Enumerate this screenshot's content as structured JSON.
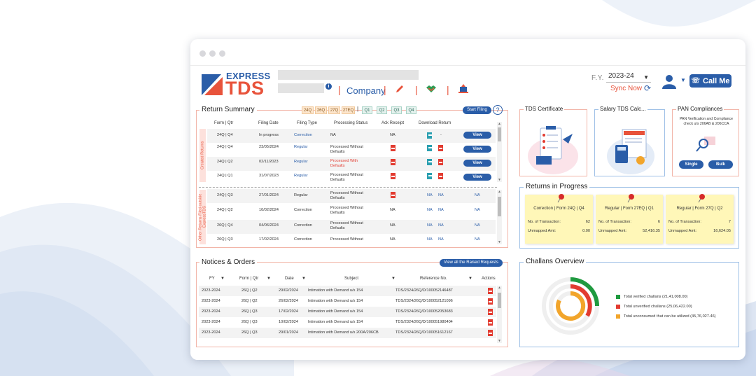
{
  "header": {
    "logo_express": "EXPRESS",
    "logo_tds": "TDS",
    "company_label": "Company",
    "fy_label": "F.Y.",
    "fy_value": "2023-24",
    "sync_now": "Sync Now",
    "call_me": "Call Me"
  },
  "return_summary": {
    "title": "Return Summary",
    "form_tags": [
      "24Q",
      "26Q",
      "27Q",
      "27EQ"
    ],
    "quarter_tags": [
      "Q1",
      "Q2",
      "Q3",
      "Q4"
    ],
    "start_filing": "Start Filing",
    "help": "?",
    "columns": [
      "Form | Qtr",
      "Filing Date",
      "Filing Type",
      "Processing Status",
      "Ack Receipt",
      "Download Return"
    ],
    "created_label": "Created Returns",
    "other_label": "Other Returns Filed outside ExpressTDS",
    "created_rows": [
      {
        "form": "24Q | Q4",
        "date": "In progress",
        "type": "Correction",
        "status": "NA",
        "ack": "NA",
        "download": "-",
        "action": "View"
      },
      {
        "form": "24Q | Q4",
        "date": "23/05/2024",
        "type": "Regular",
        "status": "Processed Without Defaults",
        "ack": "",
        "download": "",
        "action": "View"
      },
      {
        "form": "24Q | Q2",
        "date": "02/11/2023",
        "type": "Regular",
        "status": "Processed With Defaults",
        "ack": "",
        "download": "",
        "action": "View"
      },
      {
        "form": "24Q | Q1",
        "date": "31/07/2023",
        "type": "Regular",
        "status": "Processed Without Defaults",
        "ack": "",
        "download": "",
        "action": "View"
      }
    ],
    "other_rows": [
      {
        "form": "24Q | Q3",
        "date": "27/01/2024",
        "type": "Regular",
        "status": "Processed Without Defaults",
        "ack": "",
        "dl1": "NA",
        "dl2": "NA",
        "action": "NA"
      },
      {
        "form": "24Q | Q2",
        "date": "10/02/2024",
        "type": "Correction",
        "status": "Processed Without Defaults",
        "ack": "NA",
        "dl1": "NA",
        "dl2": "NA",
        "action": "NA"
      },
      {
        "form": "26Q | Q4",
        "date": "04/06/2024",
        "type": "Correction",
        "status": "Processed Without Defaults",
        "ack": "NA",
        "dl1": "NA",
        "dl2": "NA",
        "action": "NA"
      },
      {
        "form": "26Q | Q3",
        "date": "17/02/2024",
        "type": "Correction",
        "status": "Processed Without",
        "ack": "NA",
        "dl1": "NA",
        "dl2": "NA",
        "action": "NA"
      }
    ]
  },
  "notices": {
    "title": "Notices & Orders",
    "view_all": "View all the Raised Requests",
    "columns": [
      "FY",
      "Form | Qtr",
      "Date",
      "Subject",
      "Reference No.",
      "Actions"
    ],
    "rows": [
      {
        "fy": "2023-2024",
        "form": "26Q | Q2",
        "date": "29/02/2024",
        "subject": "Intimation with Demand u/s 154",
        "ref": "TDS/2324/26Q/D/100052146487"
      },
      {
        "fy": "2023-2024",
        "form": "26Q | Q2",
        "date": "26/02/2024",
        "subject": "Intimation with Demand u/s 154",
        "ref": "TDS/2324/26Q/D/100052121096"
      },
      {
        "fy": "2023-2024",
        "form": "26Q | Q3",
        "date": "17/02/2024",
        "subject": "Intimation with Demand u/s 154",
        "ref": "TDS/2324/26Q/D/100052053683"
      },
      {
        "fy": "2023-2024",
        "form": "26Q | Q3",
        "date": "10/02/2024",
        "subject": "Intimation with Demand u/s 154",
        "ref": "TDS/2324/26Q/D/100051980404"
      },
      {
        "fy": "2023-2024",
        "form": "26Q | Q3",
        "date": "29/01/2024",
        "subject": "Intimation with Demand u/s 200A/206CB",
        "ref": "TDS/2324/26Q/D/100051612167"
      }
    ]
  },
  "cards": {
    "tds_certificate": "TDS Certificate",
    "salary_calc": "Salary TDS Calc...",
    "pan_title": "PAN Compliances",
    "pan_desc": "PAN Verification and Compliance check u/s 206AB & 206CCA",
    "single": "Single",
    "bulk": "Bulk"
  },
  "returns_in_progress": {
    "title": "Returns in Progress",
    "txn_label": "No. of Transaction:",
    "amt_label": "Unmapped Amt:",
    "notes": [
      {
        "title": "Correction | Form 24Q | Q4",
        "txn": "62",
        "amt": "0.00"
      },
      {
        "title": "Regular | Form 27EQ | Q1",
        "txn": "6",
        "amt": "52,416.35"
      },
      {
        "title": "Regular | Form 27Q | Q2",
        "txn": "7",
        "amt": "16,624.05"
      }
    ]
  },
  "challans": {
    "title": "Challans Overview",
    "legend": [
      {
        "label": "Total verified challans (21,41,008.00)",
        "color": "#1f9a3f"
      },
      {
        "label": "Total unverified challans (25,06,422.00)",
        "color": "#e23b30"
      },
      {
        "label": "Total unconsumed that can be utilized (45,76,027.46)",
        "color": "#f2a52b"
      }
    ]
  },
  "colors": {
    "brand_blue": "#2a5da8",
    "brand_orange": "#e8533b"
  }
}
